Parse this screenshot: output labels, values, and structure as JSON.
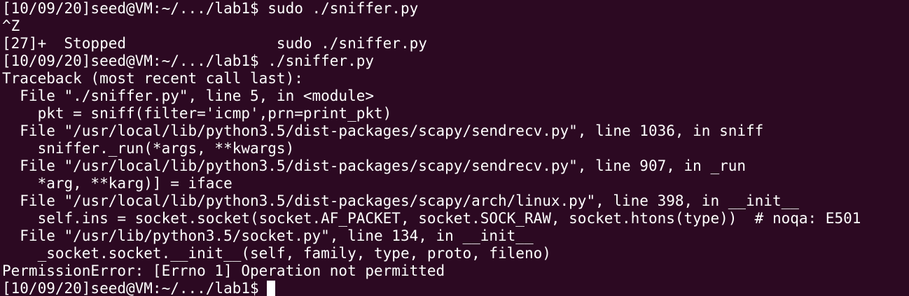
{
  "terminal": {
    "background": "#2c0922",
    "foreground": "#ffffff",
    "lines": [
      "[10/09/20]seed@VM:~/.../lab1$ sudo ./sniffer.py",
      "^Z",
      "[27]+  Stopped                 sudo ./sniffer.py",
      "[10/09/20]seed@VM:~/.../lab1$ ./sniffer.py",
      "Traceback (most recent call last):",
      "  File \"./sniffer.py\", line 5, in <module>",
      "    pkt = sniff(filter='icmp',prn=print_pkt)",
      "  File \"/usr/local/lib/python3.5/dist-packages/scapy/sendrecv.py\", line 1036, in sniff",
      "    sniffer._run(*args, **kwargs)",
      "  File \"/usr/local/lib/python3.5/dist-packages/scapy/sendrecv.py\", line 907, in _run",
      "    *arg, **karg)] = iface",
      "  File \"/usr/local/lib/python3.5/dist-packages/scapy/arch/linux.py\", line 398, in __init__",
      "    self.ins = socket.socket(socket.AF_PACKET, socket.SOCK_RAW, socket.htons(type))  # noqa: E501",
      "  File \"/usr/lib/python3.5/socket.py\", line 134, in __init__",
      "    _socket.socket.__init__(self, family, type, proto, fileno)",
      "PermissionError: [Errno 1] Operation not permitted"
    ],
    "prompt": "[10/09/20]seed@VM:~/.../lab1$"
  }
}
